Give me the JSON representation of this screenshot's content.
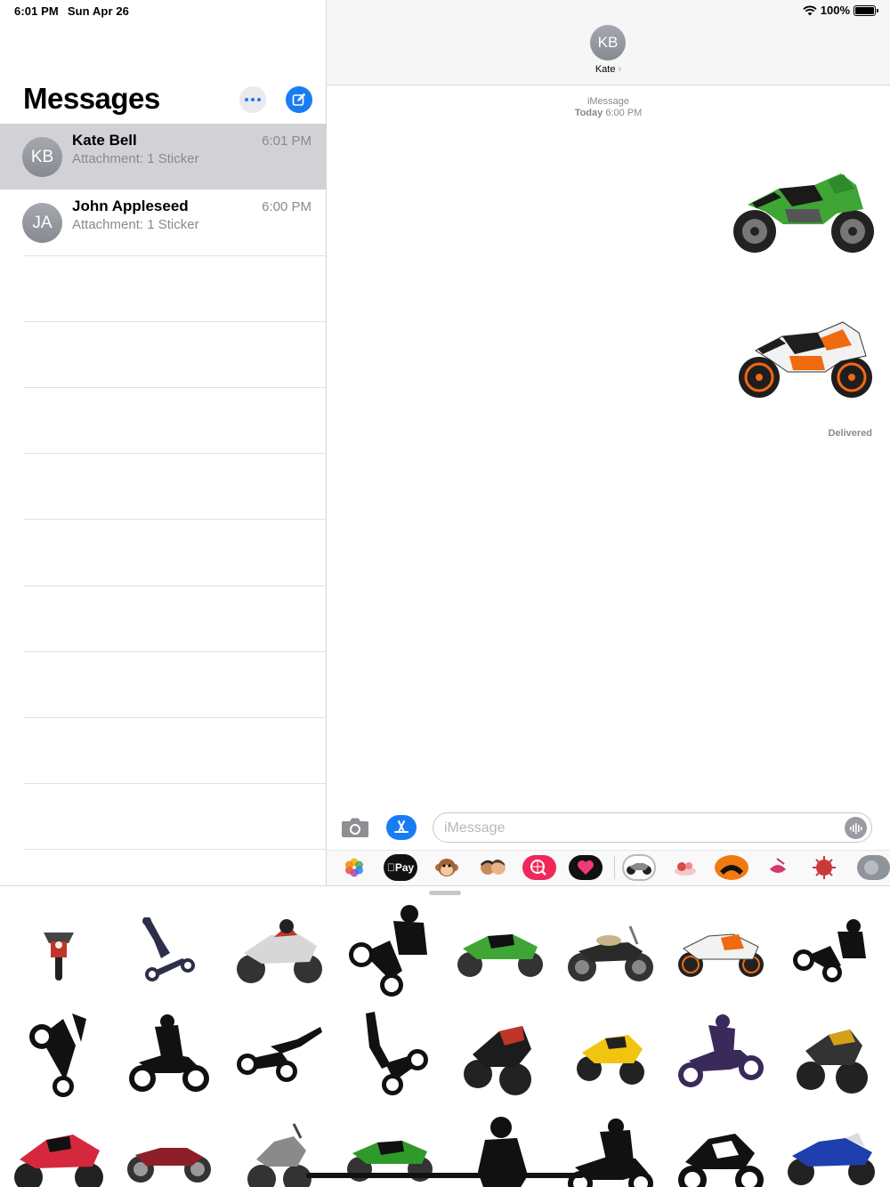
{
  "status_bar": {
    "time": "6:01 PM",
    "date": "Sun Apr 26",
    "battery": "100%"
  },
  "sidebar": {
    "title": "Messages",
    "conversations": [
      {
        "initials": "KB",
        "name": "Kate Bell",
        "preview": "Attachment: 1 Sticker",
        "time": "6:01 PM",
        "selected": true
      },
      {
        "initials": "JA",
        "name": "John Appleseed",
        "preview": "Attachment: 1 Sticker",
        "time": "6:00 PM",
        "selected": false
      }
    ]
  },
  "chat": {
    "contact_initials": "KB",
    "contact_name": "Kate",
    "service": "iMessage",
    "timestamp_day": "Today",
    "timestamp_time": "6:00 PM",
    "stickers": [
      "green-sport-bike-sticker",
      "orange-sport-bike-sticker"
    ],
    "delivered": "Delivered"
  },
  "composer": {
    "placeholder": "iMessage"
  },
  "app_strip": {
    "apps": [
      "photos-icon",
      "apple-pay-icon",
      "animoji-monkey-icon",
      "memoji-icon",
      "web-search-icon",
      "heart-sticker-icon",
      "motorbike-sticker-app-icon",
      "food-sticker-icon",
      "halloween-sticker-icon",
      "lips-sticker-icon",
      "virus-sticker-icon",
      "cat-sticker-icon"
    ],
    "apple_pay_label": "Pay"
  },
  "drawer": {
    "stickers": [
      "naked-bike-front-sticker",
      "stunt-rider-silhouette-sticker",
      "racer-sport-bike-sticker",
      "wheelie-silhouette-sticker",
      "green-sport-bike-sticker",
      "cruiser-bike-sticker",
      "orange-sport-bike-sticker",
      "wheelie-rider-silhouette-sticker",
      "stoppie-silhouette-sticker",
      "dirt-bike-rider-silhouette-sticker",
      "flying-stunt-silhouette-sticker",
      "handstand-stunt-silhouette-sticker",
      "red-black-sport-bike-sticker",
      "yellow-sport-bike-sticker",
      "purple-dirt-bike-silhouette-sticker",
      "yellow-naked-bike-sticker",
      "red-sport-bike-sticker",
      "red-cafe-racer-sticker",
      "grey-naked-bike-sticker",
      "green-ninja-bike-sticker",
      "rider-silhouette-sticker",
      "adventure-rider-silhouette-sticker",
      "touring-bike-outline-sticker",
      "blue-sport-bike-sticker"
    ]
  }
}
